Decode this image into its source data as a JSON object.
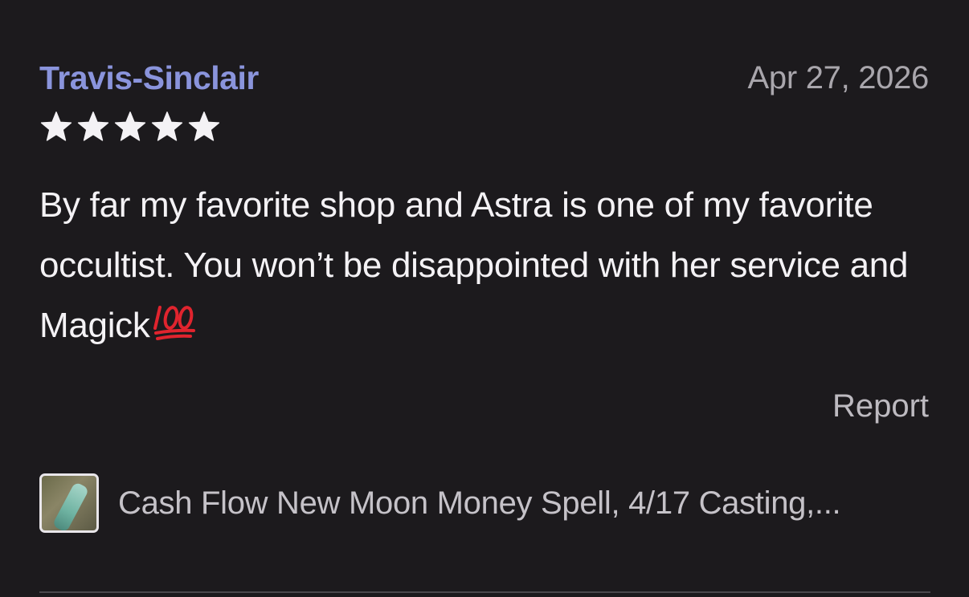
{
  "review": {
    "username": "Travis-Sinclair",
    "date": "Apr 27, 2026",
    "rating": 5,
    "rating_max": 5,
    "text": "By far my favorite shop and Astra is one of my favorite occultist. You won’t be disappointed with her service and Magick",
    "emoji_icon": "hundred-points-icon",
    "report_label": "Report"
  },
  "listing": {
    "thumbnail_icon": "listing-thumbnail",
    "title": "Cash Flow New Moon Money Spell, 4/17 Casting,..."
  },
  "colors": {
    "background": "#1c1a1d",
    "username": "#8a94dc",
    "body_text": "#f4f2f5",
    "muted_text": "#a9a6ac",
    "star": "#f4f2f5",
    "emoji": "#e0242e"
  }
}
